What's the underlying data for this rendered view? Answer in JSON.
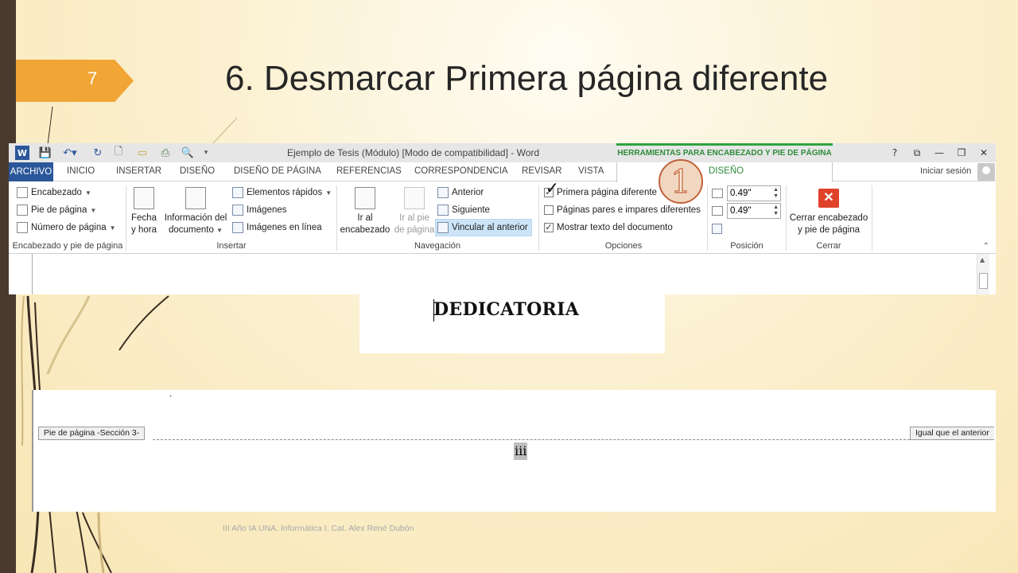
{
  "slide": {
    "number": "7",
    "title": "6. Desmarcar Primera página diferente",
    "footnote": "III Año IA UNA. Informática I. Cat. Alex René Dubón",
    "accent_color": "#f0a535",
    "callout_number": "1",
    "annotation_checkmark": "✓"
  },
  "window": {
    "title": "Ejemplo de Tesis (Módulo) [Modo de compatibilidad] - Word",
    "context_tab_group": "HERRAMIENTAS PARA ENCABEZADO Y PIE DE PÁGINA",
    "quick_access_icons": [
      "word-logo-icon",
      "save-icon",
      "undo-icon",
      "redo-icon",
      "new-doc-icon",
      "open-folder-icon",
      "print-icon",
      "print-preview-icon",
      "customize-icon"
    ],
    "controls": {
      "help": "?",
      "ribbon_options": "⧉",
      "minimize": "—",
      "restore": "❐",
      "close": "✕"
    }
  },
  "tabs": {
    "archivo": "ARCHIVO",
    "inicio": "INICIO",
    "insertar": "INSERTAR",
    "diseno": "DISEÑO",
    "diseno_pagina": "DISEÑO DE PÁGINA",
    "referencias": "REFERENCIAS",
    "correspondencia": "CORRESPONDENCIA",
    "revisar": "REVISAR",
    "vista": "VISTA",
    "diseno_context": "DISEÑO",
    "signin": "Iniciar sesión"
  },
  "ribbon": {
    "header_footer": {
      "label": "Encabezado y pie de página",
      "encabezado": "Encabezado",
      "pie": "Pie de página",
      "numero": "Número de página"
    },
    "insertar": {
      "label": "Insertar",
      "fecha_l1": "Fecha",
      "fecha_l2": "y hora",
      "info_l1": "Información del",
      "info_l2": "documento",
      "elementos": "Elementos rápidos",
      "imagenes": "Imágenes",
      "imagenes_linea": "Imágenes en línea"
    },
    "navegacion": {
      "label": "Navegación",
      "ir_enc_l1": "Ir al",
      "ir_enc_l2": "encabezado",
      "ir_pie_l1": "Ir al pie",
      "ir_pie_l2": "de página",
      "anterior": "Anterior",
      "siguiente": "Siguiente",
      "vincular": "Vincular al anterior"
    },
    "opciones": {
      "label": "Opciones",
      "primera": "Primera página diferente",
      "primera_checked": true,
      "pares": "Páginas pares e impares diferentes",
      "pares_checked": false,
      "mostrar": "Mostrar texto del documento",
      "mostrar_checked": true
    },
    "posicion": {
      "label": "Posición",
      "header_value": "0.49\"",
      "footer_value": "0.49\""
    },
    "cerrar": {
      "label": "Cerrar",
      "button_l1": "Cerrar encabezado",
      "button_l2": "y pie de página"
    }
  },
  "document": {
    "heading": "DEDICATORIA",
    "footer_label": "Pie de página -Sección 3-",
    "same_as_previous": "Igual que el anterior",
    "page_number": "iii"
  }
}
